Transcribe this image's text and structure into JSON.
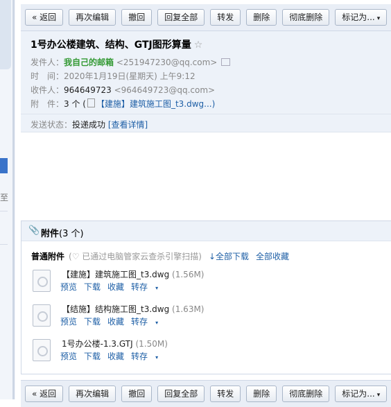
{
  "toolbar": {
    "buttons": [
      "« 返回",
      "再次编辑",
      "撤回",
      "回复全部",
      "转发",
      "删除",
      "彻底删除",
      "标记为..."
    ],
    "mark_arrow": "▾"
  },
  "mail": {
    "subject": "1号办公楼建筑、结构、GTJ图形算量",
    "star": "☆",
    "from_label": "发件人：",
    "from_name": "我自己的邮箱",
    "from_addr": "<251947230@qq.com>",
    "time_label": "时　间：",
    "time_value": "2020年1月19日(星期天) 上午9:12",
    "to_label": "收件人：",
    "to_name": "964649723",
    "to_addr": "<964649723@qq.com>",
    "attach_label": "附　件：",
    "attach_count": "3 个 (",
    "attach_first": "【建施】建筑施工图_t3.dwg...)",
    "send_state_label": "发送状态：",
    "send_state_value": "投递成功",
    "send_state_link": "[查看详情]"
  },
  "attachments": {
    "title": "附件",
    "count": "(3 个)",
    "normal_label": "普通附件",
    "scan_note": "(♡ 已通过电脑管家云查杀引擎扫描)",
    "download_all": "↓全部下载",
    "favorite_all": "全部收藏",
    "files": [
      {
        "name": "【建施】建筑施工图_t3.dwg",
        "size": "(1.56M)"
      },
      {
        "name": "【结施】结构施工图_t3.dwg",
        "size": "(1.63M)"
      },
      {
        "name": "1号办公楼-1.3.GTJ",
        "size": "(1.50M)"
      }
    ],
    "actions": {
      "preview": "预览",
      "download": "下载",
      "favorite": "收藏",
      "forward": "转存",
      "arrow": "▾"
    }
  },
  "left": {
    "glyph": "至"
  }
}
